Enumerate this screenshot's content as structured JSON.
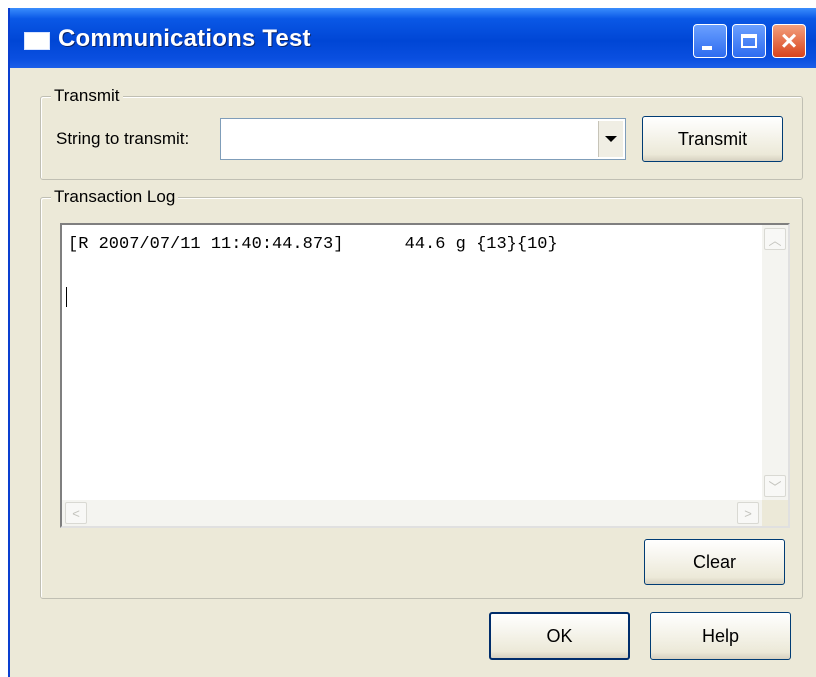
{
  "window": {
    "title": "Communications Test",
    "controls": {
      "minimize": "minimize-icon",
      "maximize": "maximize-icon",
      "close": "close-icon"
    }
  },
  "transmit_group": {
    "legend": "Transmit",
    "string_label": "String to transmit:",
    "string_value": "",
    "transmit_button": "Transmit"
  },
  "log_group": {
    "legend": "Transaction Log",
    "entries": [
      "[R 2007/07/11 11:40:44.873]      44.6 g {13}{10}"
    ],
    "clear_button": "Clear"
  },
  "footer": {
    "ok_button": "OK",
    "help_button": "Help"
  },
  "colors": {
    "titlebar": "#0046d5",
    "close_button": "#d8431c",
    "dialog_face": "#ece9d8"
  }
}
